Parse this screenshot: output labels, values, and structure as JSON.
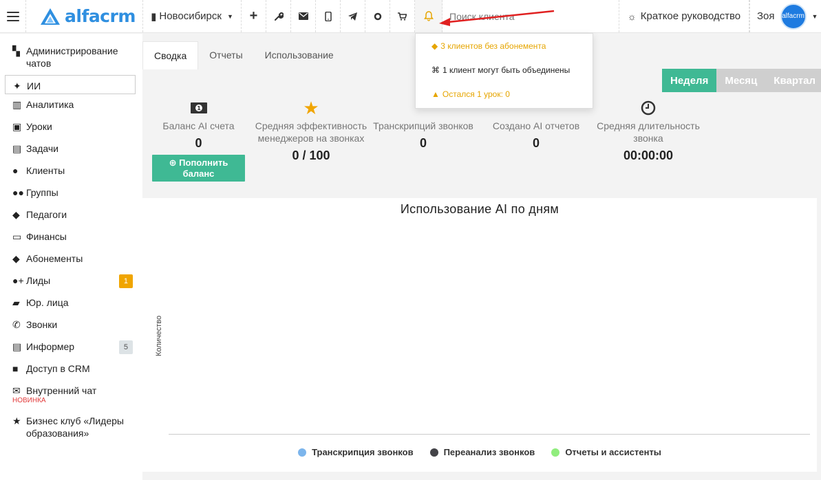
{
  "header": {
    "logo": "alfacrm",
    "city": "Новосибирск",
    "search_placeholder": "Поиск клиента",
    "guide_label": "Краткое руководство",
    "user_name": "Зоя",
    "avatar_text": "alfacrm",
    "icons": [
      "plus-icon",
      "wrench-icon",
      "mail-icon",
      "phone-icon",
      "telegram-icon",
      "refresh-icon",
      "cart-icon",
      "bell-icon"
    ]
  },
  "notifications": [
    {
      "icon": "tag-icon",
      "text": "3 клиентов без абонемента",
      "tone": "warn"
    },
    {
      "icon": "merge-icon",
      "text": "1 клиент могут быть объединены",
      "tone": "normal"
    },
    {
      "icon": "warning-icon",
      "text": "Остался 1 урок: 0",
      "tone": "warn"
    }
  ],
  "sidebar": {
    "items": [
      {
        "icon": "chat-admin-icon",
        "label": "Администрирование чатов"
      },
      {
        "icon": "sparkle-icon",
        "label": "ИИ"
      },
      {
        "icon": "map-icon",
        "label": "Аналитика"
      },
      {
        "icon": "calendar-icon",
        "label": "Уроки"
      },
      {
        "icon": "clipboard-icon",
        "label": "Задачи"
      },
      {
        "icon": "user-icon",
        "label": "Клиенты"
      },
      {
        "icon": "users-icon",
        "label": "Группы"
      },
      {
        "icon": "graduation-cap-icon",
        "label": "Педагоги"
      },
      {
        "icon": "money-icon",
        "label": "Финансы"
      },
      {
        "icon": "tag-icon",
        "label": "Абонементы"
      },
      {
        "icon": "user-plus-icon",
        "label": "Лиды",
        "badge": "1"
      },
      {
        "icon": "briefcase-icon",
        "label": "Юр. лица"
      },
      {
        "icon": "phone-icon",
        "label": "Звонки"
      },
      {
        "icon": "list-icon",
        "label": "Информер",
        "badge": "5"
      },
      {
        "icon": "lock-icon",
        "label": "Доступ в CRM"
      },
      {
        "icon": "envelope-icon",
        "label": "Внутренний чат",
        "tag": "НОВИНКА"
      },
      {
        "icon": "star-icon",
        "label": "Бизнес клуб «Лидеры образования»"
      }
    ]
  },
  "tabs": [
    "Сводка",
    "Отчеты",
    "Использование"
  ],
  "period": [
    "Неделя",
    "Месяц",
    "Квартал"
  ],
  "stats": [
    {
      "icon": "money-icon",
      "label": "Баланс AI счета",
      "value": "0",
      "button": "Пополнить баланс"
    },
    {
      "icon": "star-icon",
      "label": "Средняя эффективность менеджеров на звонках",
      "value": "0 / 100"
    },
    {
      "icon": "headset-icon",
      "label": "Транскрипций звонков",
      "value": "0"
    },
    {
      "icon": "bar-chart-icon",
      "label": "Создано AI отчетов",
      "value": "0"
    },
    {
      "icon": "clock-icon",
      "label": "Средняя длительность звонка",
      "value": "00:00:00"
    }
  ],
  "chart_data": {
    "type": "line",
    "title": "Использование AI по дням",
    "ylabel": "Количество",
    "xlabel": "",
    "series": [
      {
        "name": "Транскрипция звонков",
        "color": "#7cb5ec",
        "values": []
      },
      {
        "name": "Переанализ звонков",
        "color": "#434348",
        "values": []
      },
      {
        "name": "Отчеты и ассистенты",
        "color": "#90ed7d",
        "values": []
      }
    ],
    "legend": "bottom"
  }
}
